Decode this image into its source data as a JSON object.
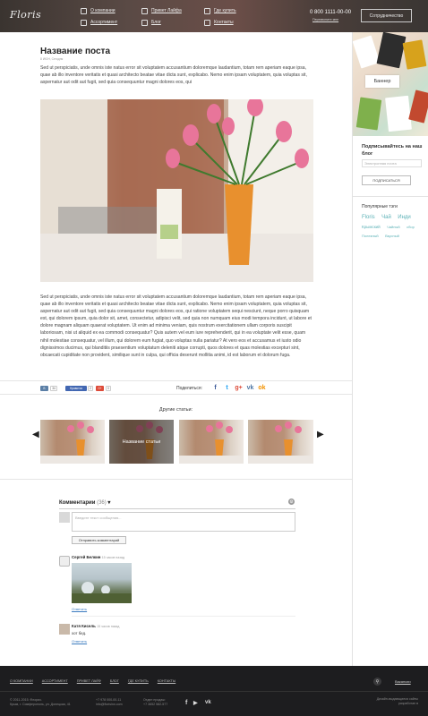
{
  "header": {
    "logo": "Floris",
    "nav_col1": [
      "О компании",
      "Ассортимент"
    ],
    "nav_col2": [
      "Привет Лайфа",
      "Блог"
    ],
    "nav_col3": [
      "Где купить",
      "Контакты"
    ],
    "phone": "0 800 1111-00-00",
    "callback": "Перезвоните мне",
    "coop_button": "Сотрудничество"
  },
  "post": {
    "title": "Название поста",
    "meta": "8 ИЮН, Сегодня",
    "intro": "Sed ut perspiciatis, unde omnis iste natus error sit voluptatem accusantium doloremque laudantium, totam rem aperiam eaque ipsa, quae ab illo inventore veritatis et quasi architecto beatae vitae dicta sunt, explicabo. Nemo enim ipsam voluptatem, quia voluptas sit, aspernatur aut odit aut fugit, sed quia consequuntur magni dolores eos, qui",
    "body": "Sed ut perspiciatis, unde omnis iste natus error sit voluptatem accusantium doloremque laudantium, totam rem aperiam eaque ipsa, quae ab illo inventore veritatis et quasi architecto beatae vitae dicta sunt, explicabo. Nemo enim ipsam voluptatem, quia voluptas sit, aspernatur aut odit aut fugit, sed quia consequuntur magni dolores eos, qui ratione voluptatem sequi nesciunt, neque porro quisquam est, qui dolorem ipsum, quia dolor sit, amet, consectetur, adipisci velit, sed quia non numquam eius modi tempora incidunt, ut labore et dolore magnam aliquam quaerat voluptatem. Ut enim ad minima veniam, quis nostrum exercitationem ullam corporis suscipit laboriosam, nisi ut aliquid ex ea commodi consequatur? Quis autem vel eum iure reprehenderit, qui in ea voluptate velit esse, quam nihil molestiae consequatur, vel illum, qui dolorem eum fugiat, quo voluptas nulla pariatur? At vero eos et accusamus et iusto odio dignissimos ducimus, qui blanditiis praesentium voluptatum deleniti atque corrupti, quos dolores et quas molestias excepturi sint, obcaecati cupiditate non provident, similique sunt in culpa, qui officia deserunt mollitia animi, id est laborum et dolorum fuga."
  },
  "share": {
    "vk_mini": "В",
    "vk_count": "34",
    "fb_mini": "Нравится",
    "fb_count": "2",
    "gplus_mini": "G+",
    "gplus_count": "0",
    "label": "Поделиться:",
    "icons": [
      "f",
      "t",
      "g+",
      "vk",
      "ok"
    ]
  },
  "other_articles": {
    "title": "Другие статьи:",
    "caption": "Название статьи"
  },
  "comments": {
    "title": "Комментарии",
    "count": "(36)",
    "placeholder": "Введите текст сообщения...",
    "send": "Отправить комментарий",
    "c1_author": "Сергей Белкин",
    "c1_time": "15 часов назад",
    "c1_reply": "Ответить",
    "c2_author": "Катя Кисель",
    "c2_time": "15 часов назад",
    "c2_text": "хот бед.",
    "c2_reply": "Ответить"
  },
  "sidebar": {
    "banner": "Баннер",
    "subscribe_title": "Подписывайтесь на наш блог",
    "email_placeholder": "Электронная почта",
    "subscribe_button": "ПОДПИСАТЬСЯ",
    "tags_title": "Популярные тэги",
    "tags": [
      "Floris",
      "Чай",
      "Инди",
      "Крымский",
      "Чайный",
      "сбор",
      "Полезный",
      "Вкусный"
    ]
  },
  "footer": {
    "nav": [
      "О КОМПАНИИ",
      "АССОРТИМЕНТ",
      "ПРИВЕТ ЛАЙФ",
      "БЛОГ",
      "ГДЕ КУПИТЬ",
      "КОНТАКТЫ"
    ],
    "login": "Вакансии",
    "copyright": "© 2011-2015. Флорис.",
    "address": "Крым, г. Симферополь, ул. Донецкая, 41",
    "phone": "+7 978 000-00-11",
    "email": "info@florisinn.com",
    "sales_label": "Отдел продаж:",
    "sales_phone": "+7 3652 582-577",
    "design_1": "Дизайн-выдающиеся сайты",
    "design_2": "разработан в"
  },
  "colors": {
    "accent": "#5db2b7",
    "footer_bg": "#1d1d1f",
    "vase": "#e8902e"
  }
}
